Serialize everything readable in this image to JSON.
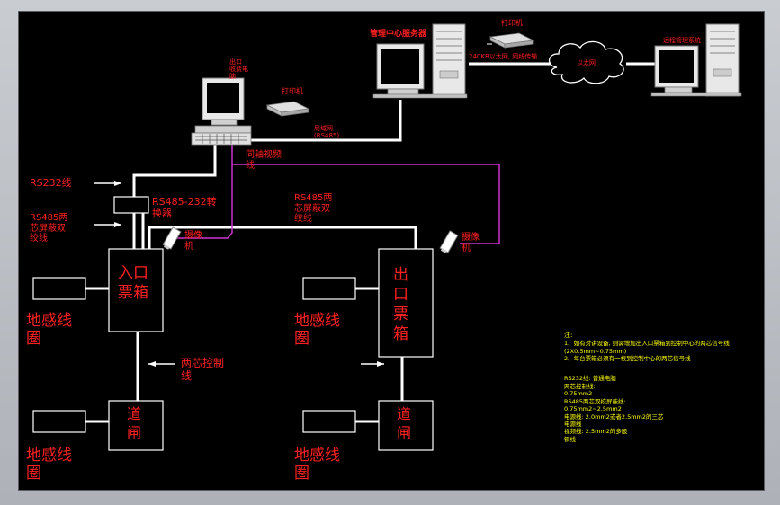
{
  "colors": {
    "canvas": "#000000",
    "wire": "#ffffff",
    "red": "#ff2020",
    "magenta": "#d030d0",
    "yellow": "#ffff00",
    "gray": "#b0b0b0"
  },
  "labels": {
    "mgmt_server": "管理中心服务器",
    "printer_top": "打印机",
    "link_240k": "240KB以太网, 网线传输",
    "ethernet": "以太网",
    "remote_mgmt": "远程管理系统",
    "lane_pc": "出口\n收费电\n脑",
    "printer_left": "打印机",
    "lan": "局域网\n(RS485)",
    "coax": "同轴视频\n线",
    "rs232": "RS232线",
    "rs485_shield": "RS485两\n芯屏蔽双\n绞线",
    "converter": "RS485-232转\n换器",
    "rs485_mid": "RS485两\n芯屏蔽双\n绞线",
    "camera": "摄像\n机",
    "camera_right": "摄像\n机",
    "entry_box": "入口\n票箱",
    "exit_box": "出\n口\n票\n箱",
    "loop1": "地感线\n圈",
    "loop2": "地感线\n圈",
    "loop3": "地感线\n圈",
    "loop4": "地感线\n圈",
    "ctrl_wire": "两芯控制\n线",
    "gate_left": "道\n闸",
    "gate_right": "道\n闸"
  },
  "notes": {
    "heading": "注:",
    "line1": "1、如有对讲设备, 则需增加出入口票箱到控制中心的两芯信号线",
    "line2": "(2X0.5mm~0.75mm)",
    "line3": "2、每台票箱必须有一根到控制中心的两芯信号线",
    "rs232": "RS232线: 普通电脑",
    "wire1": "两芯控制线:",
    "wire2": "0.75mm2",
    "wire3": "RS485两芯双绞屏蔽线:",
    "wire4": "0.75mm2~2.5mm2",
    "wire5": "电源线: 2.0mm2或者2.5mm2的三芯",
    "wire6": "电源线",
    "wire7": "视频线: 2.5mm2的多股",
    "wire8": "铜线"
  }
}
